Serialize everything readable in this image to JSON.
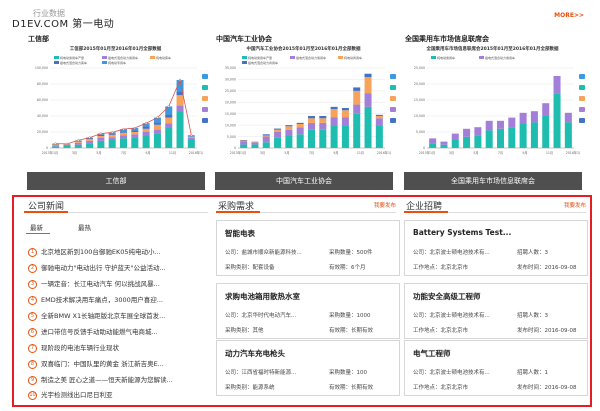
{
  "header": {
    "logo": "D1EV.COM 第一电动",
    "section_title": "行业数据",
    "more": "MORE>>"
  },
  "stats": [
    {
      "heading": "工信部",
      "chart_title": "工信部2015年01月至2016年01月全部数据",
      "button": "工信部",
      "legend": [
        "纯电动乘用车产量",
        "插电式混合动力乘用车",
        "纯电动客车",
        "插电式混合动力客车",
        "纯电动专用车"
      ],
      "y_ticks": [
        "0",
        "20,000",
        "40,000",
        "60,000",
        "80,000",
        "100,000"
      ],
      "x_ticks": [
        "2015年1月",
        "3月",
        "5月",
        "7月",
        "9月",
        "11月",
        "2016年1月"
      ]
    },
    {
      "heading": "中国汽车工业协会",
      "chart_title": "中国汽车工业协会2015年01月至2016年01月全部数据",
      "button": "中国汽车工业协会",
      "legend": [
        "纯电动乘用车产量",
        "插电式混合动力乘用车",
        "纯电动商用车",
        "插电式混合动力商用车"
      ],
      "y_ticks": [
        "0",
        "5,000",
        "10,000",
        "15,000",
        "20,000",
        "25,000",
        "30,000",
        "35,000"
      ],
      "x_ticks": [
        "2015年1月",
        "3月",
        "5月",
        "7月",
        "9月",
        "11月",
        "2016年1月"
      ]
    },
    {
      "heading": "全国乘用车市场信息联席会",
      "chart_title": "全国乘用车市场信息联席会2015年01月至2016年01月全部数据",
      "button": "全国乘用车市场信息联席会",
      "legend": [
        "纯电动乘用车",
        "插电式混合动力乘用车"
      ],
      "y_ticks": [
        "0",
        "5,000",
        "10,000",
        "15,000",
        "20,000",
        "25,000"
      ],
      "x_ticks": [
        "2015年1月",
        "3月",
        "5月",
        "7月",
        "9月",
        "11月",
        "2016年1月"
      ]
    }
  ],
  "chart_data": [
    {
      "type": "bar",
      "categories": [
        "2015年1月",
        "2月",
        "3月",
        "4月",
        "5月",
        "6月",
        "7月",
        "8月",
        "9月",
        "10月",
        "11月",
        "12月",
        "2016年1月"
      ],
      "series": [
        {
          "name": "纯电动乘用车产量",
          "values": [
            2000,
            2500,
            4000,
            6000,
            9000,
            10000,
            12000,
            13000,
            15000,
            18000,
            25000,
            45000,
            10000
          ]
        },
        {
          "name": "插电式混合动力乘用车",
          "values": [
            1500,
            1500,
            2500,
            3000,
            3500,
            3500,
            4000,
            4000,
            5000,
            5000,
            6000,
            8000,
            2500
          ]
        },
        {
          "name": "纯电动客车",
          "values": [
            1000,
            500,
            1500,
            2000,
            2500,
            3000,
            3000,
            3000,
            4000,
            6000,
            7000,
            13000,
            1500
          ]
        },
        {
          "name": "插电式混合动力客车",
          "values": [
            500,
            500,
            1000,
            1000,
            1500,
            1500,
            2000,
            2000,
            3000,
            3000,
            4000,
            5000,
            500
          ]
        },
        {
          "name": "纯电动专用车",
          "values": [
            500,
            200,
            500,
            1000,
            1500,
            1500,
            2500,
            3000,
            4000,
            6000,
            10000,
            14000,
            1500
          ]
        }
      ],
      "line": [
        5500,
        5200,
        9500,
        13000,
        18000,
        19500,
        23500,
        25000,
        31000,
        38000,
        52000,
        85000,
        16000
      ],
      "ylim": [
        0,
        100000
      ]
    },
    {
      "type": "bar",
      "categories": [
        "2015年1月",
        "2月",
        "3月",
        "4月",
        "5月",
        "6月",
        "7月",
        "8月",
        "9月",
        "10月",
        "11月",
        "12月",
        "2016年1月"
      ],
      "series": [
        {
          "name": "纯电动乘用车产量",
          "values": [
            1500,
            1500,
            2500,
            4500,
            5500,
            6000,
            8000,
            8000,
            10000,
            10000,
            15000,
            18000,
            10000
          ]
        },
        {
          "name": "插电式混合动力乘用车",
          "values": [
            1500,
            1000,
            2500,
            2500,
            2500,
            3000,
            3000,
            3000,
            3500,
            3500,
            4000,
            6000,
            3000
          ]
        },
        {
          "name": "纯电动商用车",
          "values": [
            300,
            200,
            500,
            1000,
            1500,
            1500,
            2000,
            2000,
            3500,
            3000,
            6000,
            7000,
            1000
          ]
        },
        {
          "name": "插电式混合动力商用车",
          "values": [
            200,
            100,
            500,
            500,
            500,
            500,
            1000,
            1000,
            1000,
            1000,
            1500,
            1500,
            500
          ]
        }
      ],
      "ylim": [
        0,
        35000
      ]
    },
    {
      "type": "bar",
      "categories": [
        "2015年1月",
        "2月",
        "3月",
        "4月",
        "5月",
        "6月",
        "7月",
        "8月",
        "9月",
        "10月",
        "11月",
        "12月",
        "2016年1月"
      ],
      "series": [
        {
          "name": "纯电动乘用车",
          "values": [
            1500,
            1000,
            2500,
            3500,
            4000,
            5500,
            6000,
            6500,
            7500,
            8000,
            10000,
            17000,
            8000
          ]
        },
        {
          "name": "插电式混合动力乘用车",
          "values": [
            1500,
            1000,
            2000,
            2500,
            2500,
            3000,
            2500,
            3000,
            3500,
            3500,
            4000,
            5500,
            3000
          ]
        }
      ],
      "ylim": [
        0,
        25000
      ]
    }
  ],
  "company_news": {
    "title": "公司新闻",
    "tabs": [
      "最新",
      "最热"
    ],
    "items": [
      {
        "num": "1",
        "text": "北京地区新到100台御驰EK05纯电动小..."
      },
      {
        "num": "2",
        "text": "御驰电动力\"电动出行 守护蓝天\"公益活动..."
      },
      {
        "num": "3",
        "text": "一辆定音：长江电动汽车 何以挑战风暴..."
      },
      {
        "num": "4",
        "text": "EMD技术解决用车痛点，3000用户喜迎..."
      },
      {
        "num": "5",
        "text": "全新BMW X1长轴距版北京车展全球首发..."
      },
      {
        "num": "6",
        "text": "进口带信号反馈手动助动能燃气电商城..."
      },
      {
        "num": "7",
        "text": "现阶段的电池车辆行业现状"
      },
      {
        "num": "8",
        "text": "双喜临门：中国队里的黄金 浙江新吉奥E..."
      },
      {
        "num": "9",
        "text": "制造之美 匠心之道——恒天新能源为您解读..."
      },
      {
        "num": "10",
        "text": "光宇检测线出口尼日利亚"
      }
    ]
  },
  "procurement": {
    "title": "采购需求",
    "post_label": "我要发布",
    "cards": [
      {
        "title": "智能电表",
        "company_label": "公司：",
        "company": "盐城市顺众新能源科技...",
        "qty_label": "采购数量：",
        "qty": "500件",
        "category_label": "采购类别：",
        "category": "配套设备",
        "period_label": "有效期：",
        "period": "6个月"
      },
      {
        "title": "求购电池箱用散热水室",
        "company_label": "公司：",
        "company": "北京华时代电动汽车...",
        "qty_label": "采购数量：",
        "qty": "1000",
        "category_label": "采购类别：",
        "category": "其他",
        "period_label": "有效期：",
        "period": "长期有效"
      },
      {
        "title": "动力汽车充电枪头",
        "company_label": "公司：",
        "company": "江西省福时特新能源...",
        "qty_label": "采购数量：",
        "qty": "100",
        "category_label": "采购类别：",
        "category": "能源系统",
        "period_label": "有效期：",
        "period": "长期有效"
      }
    ]
  },
  "recruitment": {
    "title": "企业招聘",
    "post_label": "我要发布",
    "cards": [
      {
        "title": "Battery Systems Test...",
        "company_label": "公司：",
        "company": "北京波士顿电池技术有...",
        "count_label": "招聘人数：",
        "count": "3",
        "location_label": "工作地点：",
        "location": "北京北京市",
        "date_label": "发布时间：",
        "date": "2016-09-08"
      },
      {
        "title": "功能安全高级工程师",
        "company_label": "公司：",
        "company": "北京波士顿电池技术有...",
        "count_label": "招聘人数：",
        "count": "3",
        "location_label": "工作地点：",
        "location": "北京北京市",
        "date_label": "发布时间：",
        "date": "2016-09-08"
      },
      {
        "title": "电气工程师",
        "company_label": "公司：",
        "company": "北京波士顿电池技术有...",
        "count_label": "招聘人数：",
        "count": "1",
        "location_label": "工作地点：",
        "location": "北京北京市",
        "date_label": "发布时间：",
        "date": "2016-09-08"
      }
    ]
  },
  "colors": {
    "accent": "#e8500e",
    "highlight_frame": "#e51c23",
    "series": [
      "#1ebdb0",
      "#a27fd8",
      "#f7a35c",
      "#4472c4",
      "#3c9be0"
    ]
  }
}
